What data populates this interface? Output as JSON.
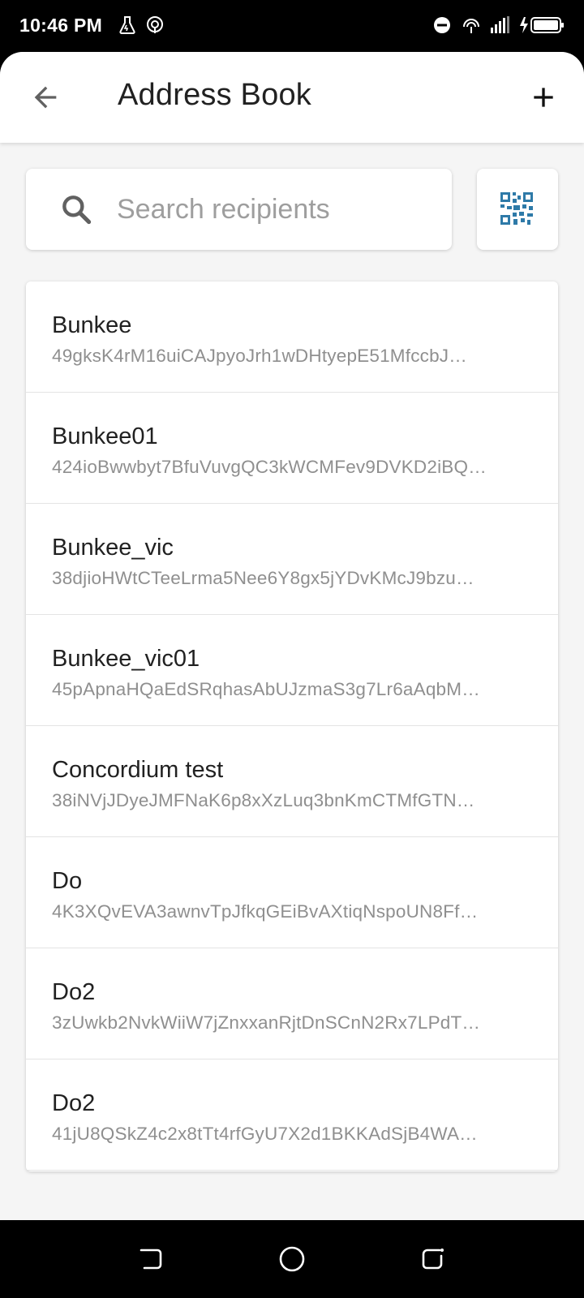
{
  "status_bar": {
    "time": "10:46 PM",
    "icons": [
      "flask-icon",
      "hotspot-icon",
      "do-not-disturb-icon",
      "wifi-calling-icon",
      "signal-icon",
      "battery-charging-icon"
    ]
  },
  "header": {
    "title": "Address Book",
    "back_icon": "arrow-left-icon",
    "add_icon": "plus-icon"
  },
  "search": {
    "placeholder": "Search recipients",
    "value": ""
  },
  "qr_button": {
    "icon": "qr-code-icon",
    "color": "#2e7aa8"
  },
  "recipients": [
    {
      "name": "Bunkee",
      "address": "49gksK4rM16uiCAJpyoJrh1wDHtyepE51MfccbJ…"
    },
    {
      "name": "Bunkee01",
      "address": "424ioBwwbyt7BfuVuvgQC3kWCMFev9DVKD2iBQ…"
    },
    {
      "name": "Bunkee_vic",
      "address": "38djioHWtCTeeLrma5Nee6Y8gx5jYDvKMcJ9bzu…"
    },
    {
      "name": "Bunkee_vic01",
      "address": "45pApnaHQaEdSRqhasAbUJzmaS3g7Lr6aAqbM…"
    },
    {
      "name": "Concordium test",
      "address": "38iNVjJDyeJMFNaK6p8xXzLuq3bnKmCTMfGTN…"
    },
    {
      "name": "Do",
      "address": "4K3XQvEVA3awnvTpJfkqGEiBvAXtiqNspoUN8Ff…"
    },
    {
      "name": "Do2",
      "address": "3zUwkb2NvkWiiW7jZnxxanRjtDnSCnN2Rx7LPdT…"
    },
    {
      "name": "Do2",
      "address": "41jU8QSkZ4c2x8tTt4rfGyU7X2d1BKKAdSjB4WA…"
    }
  ],
  "nav_bar": {
    "icons": [
      "back-nav-icon",
      "home-nav-icon",
      "recents-nav-icon"
    ]
  }
}
